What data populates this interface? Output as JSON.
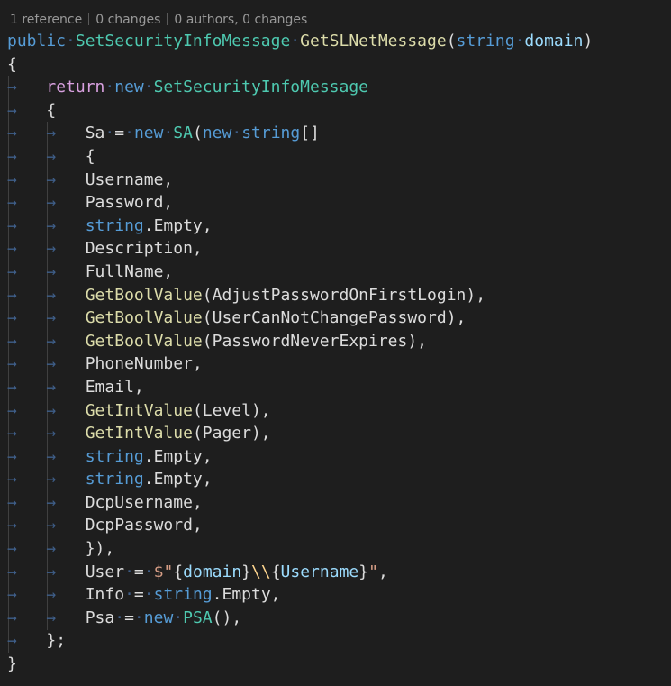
{
  "codelens": {
    "references": "1 reference",
    "changes": "0 changes",
    "authors": "0 authors, 0 changes"
  },
  "colors": {
    "background": "#1e1e1e",
    "keyword": "#569cd6",
    "control_keyword": "#d8a0df",
    "type": "#4ec9b0",
    "method": "#dcdcaa",
    "parameter": "#9cdcfe",
    "string": "#d69d85",
    "escape": "#ffd68f",
    "plain": "#dcdcdc",
    "whitespace_marker": "#3f5f8a"
  },
  "code_lines": [
    [
      [
        "kw",
        "public"
      ],
      [
        "ws",
        "·"
      ],
      [
        "type",
        "SetSecurityInfoMessage"
      ],
      [
        "ws",
        "·"
      ],
      [
        "meth",
        "GetSLNetMessage"
      ],
      [
        "pl",
        "("
      ],
      [
        "kw",
        "string"
      ],
      [
        "ws",
        "·"
      ],
      [
        "prm",
        "domain"
      ],
      [
        "pl",
        ")"
      ]
    ],
    [
      [
        "pl",
        "{"
      ]
    ],
    [
      [
        "ws",
        "→"
      ],
      [
        "ws",
        "   "
      ],
      [
        "ctl",
        "return"
      ],
      [
        "ws",
        "·"
      ],
      [
        "kw",
        "new"
      ],
      [
        "ws",
        "·"
      ],
      [
        "type",
        "SetSecurityInfoMessage"
      ]
    ],
    [
      [
        "ws",
        "→"
      ],
      [
        "ws",
        "   "
      ],
      [
        "pl",
        "{"
      ]
    ],
    [
      [
        "ws",
        "→"
      ],
      [
        "ws",
        "   "
      ],
      [
        "ws",
        "→"
      ],
      [
        "ws",
        "   "
      ],
      [
        "pl",
        "Sa"
      ],
      [
        "ws",
        "·"
      ],
      [
        "pl",
        "="
      ],
      [
        "ws",
        "·"
      ],
      [
        "kw",
        "new"
      ],
      [
        "ws",
        "·"
      ],
      [
        "type",
        "SA"
      ],
      [
        "pl",
        "("
      ],
      [
        "kw",
        "new"
      ],
      [
        "ws",
        "·"
      ],
      [
        "kw",
        "string"
      ],
      [
        "pl",
        "[]"
      ]
    ],
    [
      [
        "ws",
        "→"
      ],
      [
        "ws",
        "   "
      ],
      [
        "ws",
        "→"
      ],
      [
        "ws",
        "   "
      ],
      [
        "pl",
        "{"
      ]
    ],
    [
      [
        "ws",
        "→"
      ],
      [
        "ws",
        "   "
      ],
      [
        "ws",
        "→"
      ],
      [
        "ws",
        "   "
      ],
      [
        "pl",
        "Username,"
      ]
    ],
    [
      [
        "ws",
        "→"
      ],
      [
        "ws",
        "   "
      ],
      [
        "ws",
        "→"
      ],
      [
        "ws",
        "   "
      ],
      [
        "pl",
        "Password,"
      ]
    ],
    [
      [
        "ws",
        "→"
      ],
      [
        "ws",
        "   "
      ],
      [
        "ws",
        "→"
      ],
      [
        "ws",
        "   "
      ],
      [
        "kw",
        "string"
      ],
      [
        "pl",
        ".Empty,"
      ]
    ],
    [
      [
        "ws",
        "→"
      ],
      [
        "ws",
        "   "
      ],
      [
        "ws",
        "→"
      ],
      [
        "ws",
        "   "
      ],
      [
        "pl",
        "Description,"
      ]
    ],
    [
      [
        "ws",
        "→"
      ],
      [
        "ws",
        "   "
      ],
      [
        "ws",
        "→"
      ],
      [
        "ws",
        "   "
      ],
      [
        "pl",
        "FullName,"
      ]
    ],
    [
      [
        "ws",
        "→"
      ],
      [
        "ws",
        "   "
      ],
      [
        "ws",
        "→"
      ],
      [
        "ws",
        "   "
      ],
      [
        "meth",
        "GetBoolValue"
      ],
      [
        "pl",
        "(AdjustPasswordOnFirstLogin),"
      ]
    ],
    [
      [
        "ws",
        "→"
      ],
      [
        "ws",
        "   "
      ],
      [
        "ws",
        "→"
      ],
      [
        "ws",
        "   "
      ],
      [
        "meth",
        "GetBoolValue"
      ],
      [
        "pl",
        "(UserCanNotChangePassword),"
      ]
    ],
    [
      [
        "ws",
        "→"
      ],
      [
        "ws",
        "   "
      ],
      [
        "ws",
        "→"
      ],
      [
        "ws",
        "   "
      ],
      [
        "meth",
        "GetBoolValue"
      ],
      [
        "pl",
        "(PasswordNeverExpires),"
      ]
    ],
    [
      [
        "ws",
        "→"
      ],
      [
        "ws",
        "   "
      ],
      [
        "ws",
        "→"
      ],
      [
        "ws",
        "   "
      ],
      [
        "pl",
        "PhoneNumber,"
      ]
    ],
    [
      [
        "ws",
        "→"
      ],
      [
        "ws",
        "   "
      ],
      [
        "ws",
        "→"
      ],
      [
        "ws",
        "   "
      ],
      [
        "pl",
        "Email,"
      ]
    ],
    [
      [
        "ws",
        "→"
      ],
      [
        "ws",
        "   "
      ],
      [
        "ws",
        "→"
      ],
      [
        "ws",
        "   "
      ],
      [
        "meth",
        "GetIntValue"
      ],
      [
        "pl",
        "(Level),"
      ]
    ],
    [
      [
        "ws",
        "→"
      ],
      [
        "ws",
        "   "
      ],
      [
        "ws",
        "→"
      ],
      [
        "ws",
        "   "
      ],
      [
        "meth",
        "GetIntValue"
      ],
      [
        "pl",
        "(Pager),"
      ]
    ],
    [
      [
        "ws",
        "→"
      ],
      [
        "ws",
        "   "
      ],
      [
        "ws",
        "→"
      ],
      [
        "ws",
        "   "
      ],
      [
        "kw",
        "string"
      ],
      [
        "pl",
        ".Empty,"
      ]
    ],
    [
      [
        "ws",
        "→"
      ],
      [
        "ws",
        "   "
      ],
      [
        "ws",
        "→"
      ],
      [
        "ws",
        "   "
      ],
      [
        "kw",
        "string"
      ],
      [
        "pl",
        ".Empty,"
      ]
    ],
    [
      [
        "ws",
        "→"
      ],
      [
        "ws",
        "   "
      ],
      [
        "ws",
        "→"
      ],
      [
        "ws",
        "   "
      ],
      [
        "pl",
        "DcpUsername,"
      ]
    ],
    [
      [
        "ws",
        "→"
      ],
      [
        "ws",
        "   "
      ],
      [
        "ws",
        "→"
      ],
      [
        "ws",
        "   "
      ],
      [
        "pl",
        "DcpPassword,"
      ]
    ],
    [
      [
        "ws",
        "→"
      ],
      [
        "ws",
        "   "
      ],
      [
        "ws",
        "→"
      ],
      [
        "ws",
        "   "
      ],
      [
        "pl",
        "}),"
      ]
    ],
    [
      [
        "ws",
        "→"
      ],
      [
        "ws",
        "   "
      ],
      [
        "ws",
        "→"
      ],
      [
        "ws",
        "   "
      ],
      [
        "pl",
        "User"
      ],
      [
        "ws",
        "·"
      ],
      [
        "pl",
        "="
      ],
      [
        "ws",
        "·"
      ],
      [
        "str",
        "$\""
      ],
      [
        "pl",
        "{"
      ],
      [
        "prm",
        "domain"
      ],
      [
        "pl",
        "}"
      ],
      [
        "esc",
        "\\\\"
      ],
      [
        "pl",
        "{"
      ],
      [
        "prm",
        "Username"
      ],
      [
        "pl",
        "}"
      ],
      [
        "str",
        "\""
      ],
      [
        "pl",
        ","
      ]
    ],
    [
      [
        "ws",
        "→"
      ],
      [
        "ws",
        "   "
      ],
      [
        "ws",
        "→"
      ],
      [
        "ws",
        "   "
      ],
      [
        "pl",
        "Info"
      ],
      [
        "ws",
        "·"
      ],
      [
        "pl",
        "="
      ],
      [
        "ws",
        "·"
      ],
      [
        "kw",
        "string"
      ],
      [
        "pl",
        ".Empty,"
      ]
    ],
    [
      [
        "ws",
        "→"
      ],
      [
        "ws",
        "   "
      ],
      [
        "ws",
        "→"
      ],
      [
        "ws",
        "   "
      ],
      [
        "pl",
        "Psa"
      ],
      [
        "ws",
        "·"
      ],
      [
        "pl",
        "="
      ],
      [
        "ws",
        "·"
      ],
      [
        "kw",
        "new"
      ],
      [
        "ws",
        "·"
      ],
      [
        "type",
        "PSA"
      ],
      [
        "pl",
        "(),"
      ]
    ],
    [
      [
        "ws",
        "→"
      ],
      [
        "ws",
        "   "
      ],
      [
        "pl",
        "};"
      ]
    ],
    [
      [
        "pl",
        "}"
      ]
    ]
  ]
}
